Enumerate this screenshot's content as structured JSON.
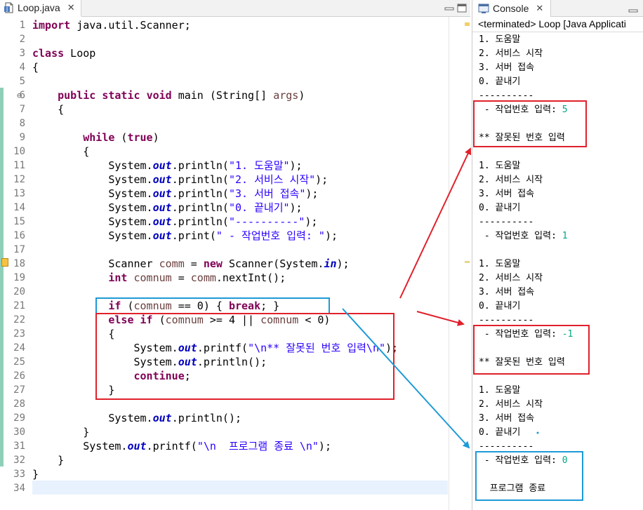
{
  "editor": {
    "tab_title": "Loop.java",
    "line_numbers": [
      "1",
      "2",
      "3",
      "4",
      "5",
      "6",
      "7",
      "8",
      "9",
      "10",
      "11",
      "12",
      "13",
      "14",
      "15",
      "16",
      "17",
      "18",
      "19",
      "20",
      "21",
      "22",
      "23",
      "24",
      "25",
      "26",
      "27",
      "28",
      "29",
      "30",
      "31",
      "32",
      "33",
      "34"
    ],
    "lines": [
      "import java.util.Scanner;",
      "",
      "class Loop",
      "{",
      "",
      "    public static void main (String[] args)",
      "    {",
      "",
      "        while (true)",
      "        {",
      "            System.out.println(\"1. 도움말\");",
      "            System.out.println(\"2. 서비스 시작\");",
      "            System.out.println(\"3. 서버 접속\");",
      "            System.out.println(\"0. 끝내기\");",
      "            System.out.println(\"----------\");",
      "            System.out.print(\" - 작업번호 입력: \");",
      "",
      "            Scanner comm = new Scanner(System.in);",
      "            int comnum = comm.nextInt();",
      "",
      "            if (comnum == 0) { break; }",
      "            else if (comnum >= 4 || comnum < 0)",
      "            {",
      "                System.out.printf(\"\\n** 잘못된 번호 입력\\n\");",
      "                System.out.println();",
      "                continue;",
      "            }",
      "",
      "            System.out.println();",
      "        }",
      "        System.out.printf(\"\\n  프로그램 종료 \\n\");",
      "    }",
      "}",
      ""
    ]
  },
  "console": {
    "tab_title": "Console",
    "status": "<terminated> Loop [Java Applicati",
    "lines": [
      {
        "text": "1. 도움말"
      },
      {
        "text": "2. 서비스 시작"
      },
      {
        "text": "3. 서버 접속"
      },
      {
        "text": "0. 끝내기"
      },
      {
        "text": "----------"
      },
      {
        "text": " - 작업번호 입력: ",
        "input": "5"
      },
      {
        "text": ""
      },
      {
        "text": "** 잘못된 번호 입력"
      },
      {
        "text": ""
      },
      {
        "text": "1. 도움말"
      },
      {
        "text": "2. 서비스 시작"
      },
      {
        "text": "3. 서버 접속"
      },
      {
        "text": "0. 끝내기"
      },
      {
        "text": "----------"
      },
      {
        "text": " - 작업번호 입력: ",
        "input": "1"
      },
      {
        "text": ""
      },
      {
        "text": "1. 도움말"
      },
      {
        "text": "2. 서비스 시작"
      },
      {
        "text": "3. 서버 접속"
      },
      {
        "text": "0. 끝내기"
      },
      {
        "text": "----------"
      },
      {
        "text": " - 작업번호 입력: ",
        "input": "-1"
      },
      {
        "text": ""
      },
      {
        "text": "** 잘못된 번호 입력"
      },
      {
        "text": ""
      },
      {
        "text": "1. 도움말"
      },
      {
        "text": "2. 서비스 시작"
      },
      {
        "text": "3. 서버 접속"
      },
      {
        "text": "0. 끝내기"
      },
      {
        "text": "----------"
      },
      {
        "text": " - 작업번호 입력: ",
        "input": "0"
      },
      {
        "text": ""
      },
      {
        "text": "  프로그램 종료"
      }
    ]
  },
  "colors": {
    "keyword": "#7f0055",
    "string": "#2a00ff",
    "field": "#0000c0",
    "local_var": "#6a3e3e",
    "console_input": "#00a882",
    "annotation_red": "#e0212b",
    "annotation_blue": "#1e9ad6"
  },
  "icons": {
    "editor_tab": "java-file-icon",
    "console_tab": "console-icon",
    "close": "close-icon"
  }
}
